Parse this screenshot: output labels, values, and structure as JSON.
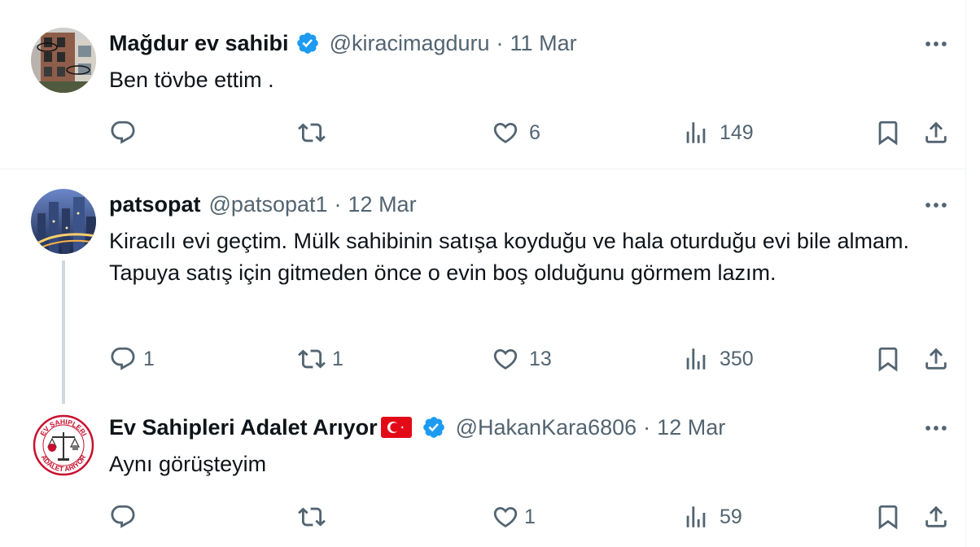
{
  "tweets": [
    {
      "name": "Mağdur ev sahibi",
      "verified": true,
      "handle": "@kiracimagduru",
      "date": "11 Mar",
      "text": "Ben tövbe ettim .",
      "replies": "",
      "retweets": "",
      "likes": "6",
      "views": "149",
      "avatar": "building-photo"
    },
    {
      "name": "patsopat",
      "verified": false,
      "handle": "@patsopat1",
      "date": "12 Mar",
      "text": "Kiracılı evi geçtim. Mülk sahibinin satışa koyduğu ve hala oturduğu evi bile almam. Tapuya satış için gitmeden önce o evin boş olduğunu görmem lazım.",
      "replies": "1",
      "retweets": "1",
      "likes": "13",
      "views": "350",
      "avatar": "city-night-photo"
    },
    {
      "name": "Ev Sahipleri Adalet Arıyor",
      "verified": true,
      "flag": "turkey-flag-emoji",
      "handle": "@HakanKara6806",
      "date": "12 Mar",
      "text": "Aynı görüşteyim",
      "replies": "",
      "retweets": "",
      "likes": "1",
      "views": "59",
      "avatar_ring_text": "EV SAHIPLERI ADALET ARIYOR",
      "avatar": "scales-of-justice-logo"
    }
  ],
  "separator": "·",
  "icons": {
    "reply": "reply-icon",
    "retweet": "retweet-icon",
    "like": "heart-icon",
    "views": "views-icon",
    "bookmark": "bookmark-icon",
    "share": "share-icon",
    "more": "more-icon",
    "verified": "verified-badge-icon"
  },
  "colors": {
    "verified": "#1d9bf0",
    "text_primary": "#0f1419",
    "text_secondary": "#536471",
    "thread_line": "#cfd9de",
    "flag_red": "#e30a17"
  }
}
